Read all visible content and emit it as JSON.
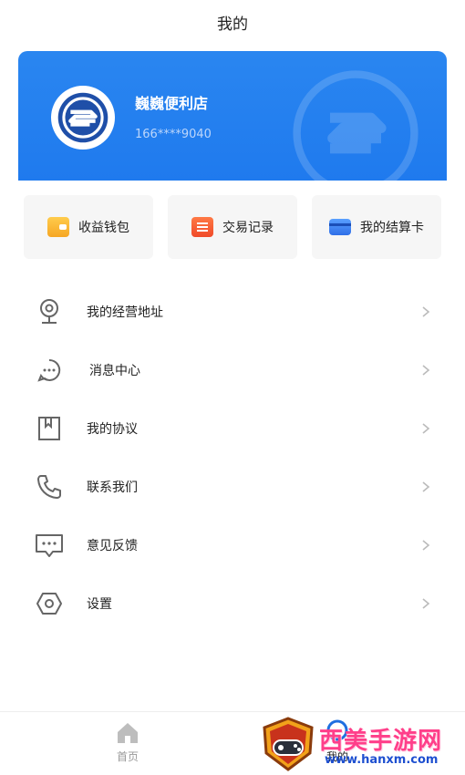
{
  "header": {
    "title": "我的"
  },
  "profile": {
    "name": "巍巍便利店",
    "phone": "166****9040"
  },
  "quick_actions": [
    {
      "label": "收益钱包",
      "icon": "wallet-icon"
    },
    {
      "label": "交易记录",
      "icon": "record-icon"
    },
    {
      "label": "我的结算卡",
      "icon": "card-icon"
    }
  ],
  "menu": [
    {
      "label": "我的经营地址",
      "icon": "location-icon"
    },
    {
      "label": "消息中心",
      "icon": "message-icon"
    },
    {
      "label": "我的协议",
      "icon": "agreement-icon"
    },
    {
      "label": "联系我们",
      "icon": "phone-icon"
    },
    {
      "label": "意见反馈",
      "icon": "feedback-icon"
    },
    {
      "label": "设置",
      "icon": "settings-icon"
    }
  ],
  "tabbar": {
    "home_label": "首页",
    "mine_label": "我的"
  },
  "watermark": {
    "text": "西美手游网",
    "url": "www.hanxm.com"
  },
  "colors": {
    "primary": "#2a86f0",
    "text": "#222222",
    "muted": "#999999"
  }
}
